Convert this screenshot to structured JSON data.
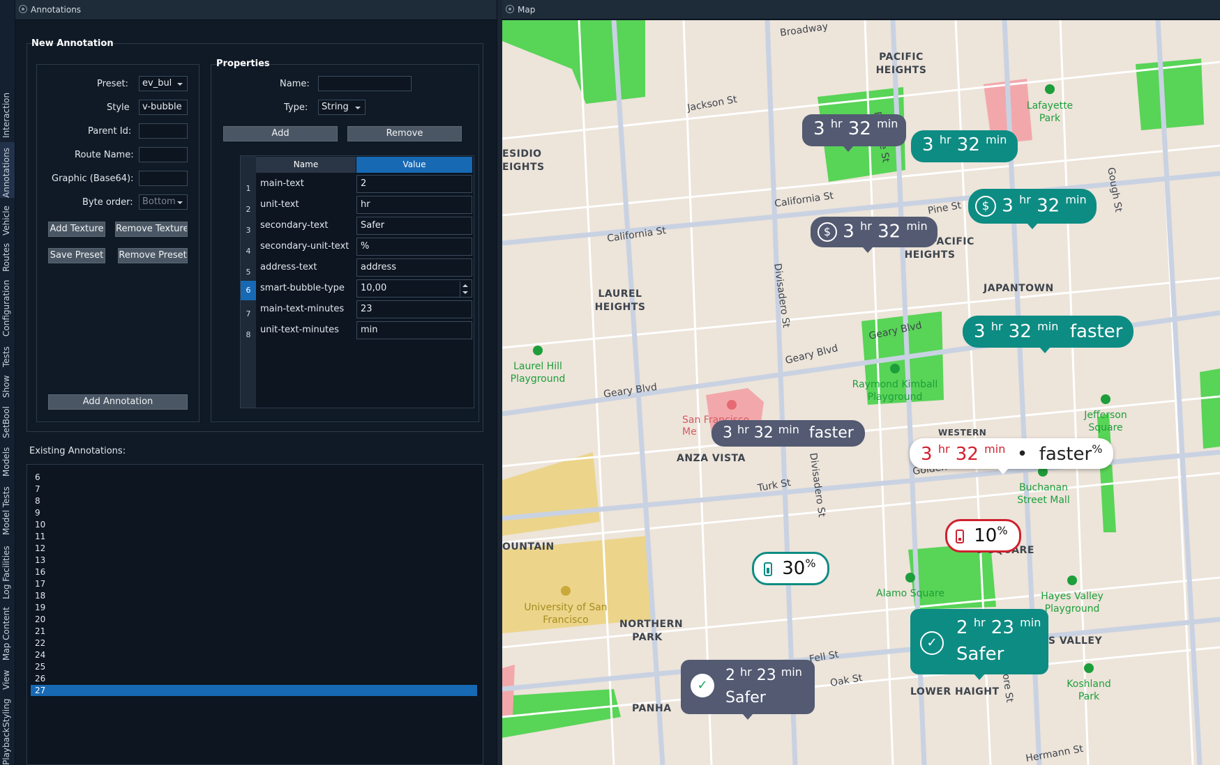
{
  "vertical_tabs": [
    {
      "label": "Interaction",
      "active": false
    },
    {
      "label": "Annotations",
      "active": true
    },
    {
      "label": "Vehicle",
      "active": false
    },
    {
      "label": "Routes",
      "active": false
    },
    {
      "label": "Configuration",
      "active": false
    },
    {
      "label": "Tests",
      "active": false
    },
    {
      "label": "Show",
      "active": false
    },
    {
      "label": "SetBool",
      "active": false
    },
    {
      "label": "Models",
      "active": false
    },
    {
      "label": "Model Tests",
      "active": false
    },
    {
      "label": "Log Facilities",
      "active": false
    },
    {
      "label": "Map Content",
      "active": false
    },
    {
      "label": "View",
      "active": false
    },
    {
      "label": "Styling",
      "active": false
    },
    {
      "label": "Playback",
      "active": false
    }
  ],
  "annotations_panel": {
    "title": "Annotations",
    "new_annotation": {
      "group_title": "New Annotation",
      "preset_label": "Preset:",
      "preset_value": "ev_bul",
      "style_label": "Style",
      "style_value": "v-bubble",
      "parent_id_label": "Parent Id:",
      "parent_id_value": "",
      "route_name_label": "Route Name:",
      "route_name_value": "",
      "graphic_label": "Graphic (Base64):",
      "graphic_value": "",
      "byte_order_label": "Byte order:",
      "byte_order_value": "Bottom",
      "add_texture": "Add Texture",
      "remove_texture": "Remove Texture",
      "save_preset": "Save Preset",
      "remove_preset": "Remove Preset",
      "add_annotation": "Add Annotation"
    },
    "properties": {
      "group_title": "Properties",
      "name_label": "Name:",
      "name_value": "",
      "type_label": "Type:",
      "type_value": "String",
      "add": "Add",
      "remove": "Remove",
      "col_name": "Name",
      "col_value": "Value",
      "rows": [
        {
          "num": "1",
          "name": "main-text",
          "value": "2"
        },
        {
          "num": "2",
          "name": "unit-text",
          "value": "hr"
        },
        {
          "num": "3",
          "name": "secondary-text",
          "value": "Safer"
        },
        {
          "num": "4",
          "name": "secondary-unit-text",
          "value": "%"
        },
        {
          "num": "5",
          "name": "address-text",
          "value": "address"
        },
        {
          "num": "6",
          "name": "smart-bubble-type",
          "value": "10,00"
        },
        {
          "num": "7",
          "name": "main-text-minutes",
          "value": "23"
        },
        {
          "num": "8",
          "name": "unit-text-minutes",
          "value": "min"
        }
      ]
    },
    "existing_label": "Existing Annotations:",
    "existing": [
      "6",
      "7",
      "8",
      "9",
      "10",
      "11",
      "12",
      "13",
      "16",
      "17",
      "18",
      "19",
      "20",
      "21",
      "22",
      "24",
      "25",
      "26",
      "27"
    ],
    "existing_selected": "27"
  },
  "map_panel": {
    "title": "Map",
    "streets": {
      "broadway": "Broadway",
      "jackson": "Jackson St",
      "california_left": "California St",
      "california_right": "California St",
      "pine": "Pine St",
      "geary_left": "Geary Blvd",
      "geary_mid": "Geary Blvd",
      "geary_right": "Geary Blvd",
      "turk": "Turk St",
      "golden_gate": "Golden Gate Ave",
      "fell": "Fell St",
      "oak": "Oak St",
      "hermann": "Hermann St",
      "fillmore_top": "Fillmore St",
      "fillmore_bottom": "Fillmore St",
      "divisadero_top": "Divisadero St",
      "divisadero_bottom": "Divisadero St",
      "gough": "Gough St"
    },
    "neighborhoods": {
      "pacific_heights": "PACIFIC HEIGHTS",
      "presidio_heights": "ESIDIO EIGHTS",
      "lower_pacific_heights": "LOWER PACIFIC HEIGHTS",
      "laurel_heights": "LAUREL HEIGHTS",
      "japantown": "JAPANTOWN",
      "anza_vista": "ANZA VISTA",
      "western": "WESTERN",
      "alamo_square": "O SQUARE",
      "fountain": "OUNTAIN",
      "northern_park": "NORTHERN PARK",
      "hayes_valley": "HAYES VALLEY",
      "lower_haight": "LOWER HAIGHT",
      "panhandle": "PANHA"
    },
    "parks": {
      "lafayette": "Lafayette Park",
      "laurel_hill": "Laurel Hill Playground",
      "raymond_kimball": "Raymond Kimball Playground",
      "jefferson": "Jefferson Square",
      "buchanan": "Buchanan Street Mall",
      "alamo": "Alamo Square",
      "hayes_valley_pg": "Hayes Valley Playground",
      "koshland": "Koshland Park"
    },
    "university": "University of San Francisco",
    "hospital": "San Francisco Me",
    "bubbles": {
      "b1": {
        "main": "3",
        "unit": "hr",
        "minutes": "32",
        "min_unit": "min"
      },
      "b2": {
        "main": "3",
        "unit": "hr",
        "minutes": "32",
        "min_unit": "min"
      },
      "b3": {
        "main": "3",
        "unit": "hr",
        "minutes": "32",
        "min_unit": "min"
      },
      "b4": {
        "main": "3",
        "unit": "hr",
        "minutes": "32",
        "min_unit": "min"
      },
      "b5": {
        "main": "3",
        "unit": "hr",
        "minutes": "32",
        "min_unit": "min",
        "secondary": "faster"
      },
      "b6": {
        "main": "3",
        "unit": "hr",
        "minutes": "32",
        "min_unit": "min",
        "secondary": "faster"
      },
      "b7": {
        "main": "3",
        "unit": "hr",
        "minutes": "32",
        "min_unit": "min",
        "secondary": "faster",
        "secondary_unit": "%"
      },
      "b8": {
        "value": "10",
        "unit": "%"
      },
      "b9": {
        "value": "30",
        "unit": "%"
      },
      "b10": {
        "main": "2",
        "unit": "hr",
        "minutes": "23",
        "min_unit": "min",
        "secondary": "Safer"
      },
      "b11": {
        "main": "2",
        "unit": "hr",
        "minutes": "23",
        "min_unit": "min",
        "secondary": "Safer"
      }
    },
    "colors": {
      "dark_bubble": "#535a72",
      "teal_bubble": "#0d8c83",
      "warning_red": "#d0202e",
      "park_green": "#58d457",
      "map_bg": "#ede4da"
    }
  }
}
